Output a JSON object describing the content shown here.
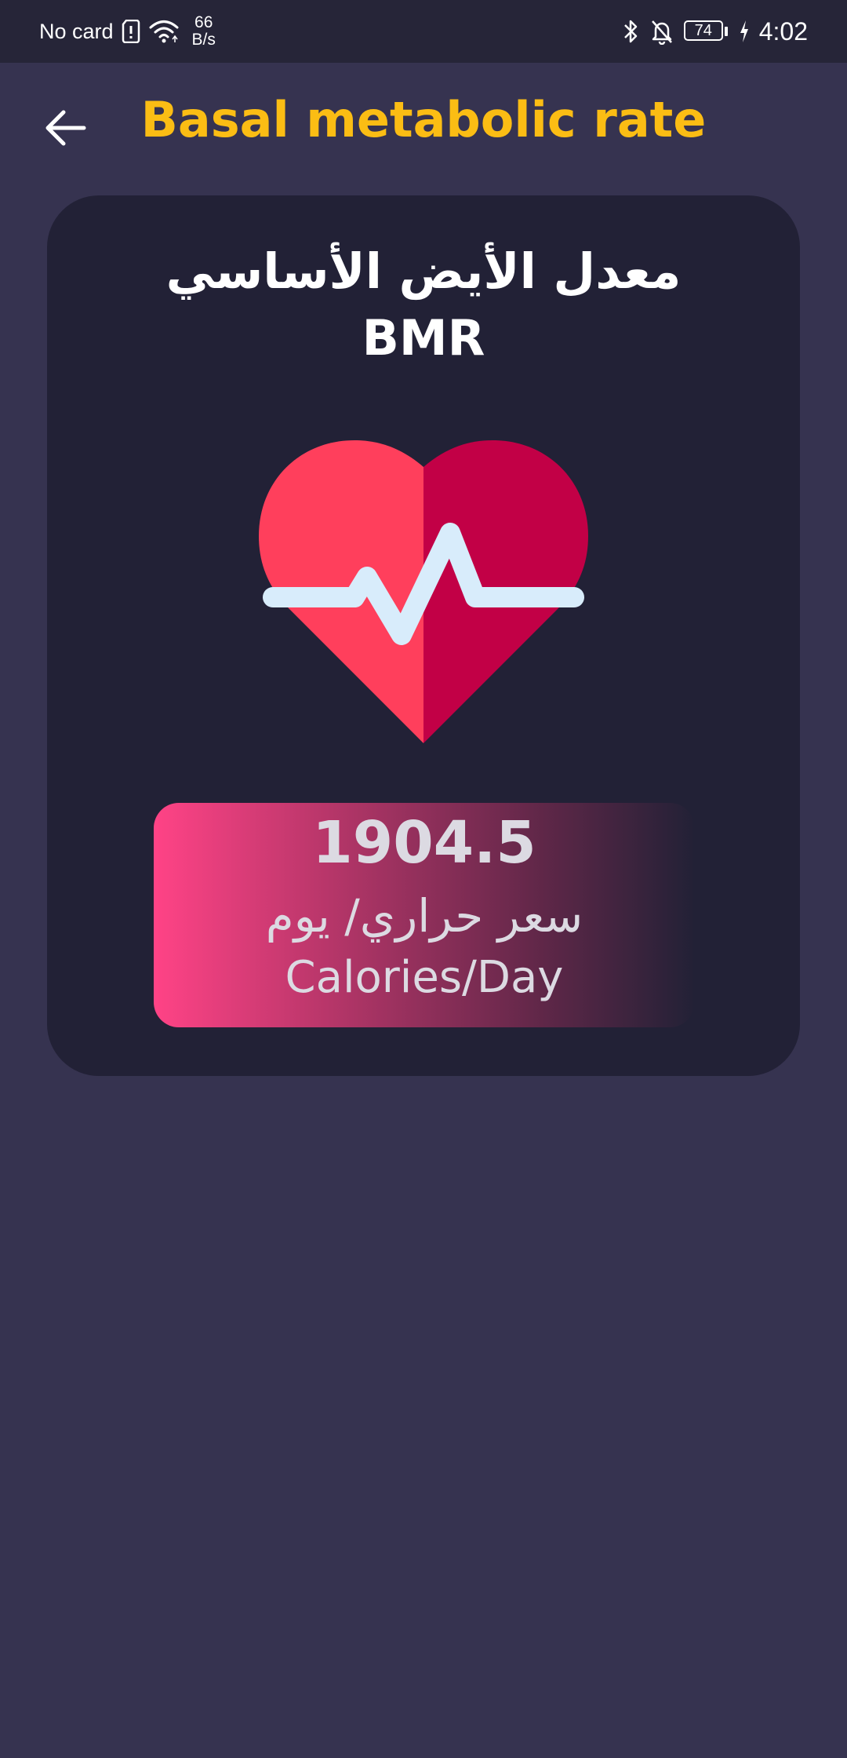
{
  "status_bar": {
    "carrier": "No card",
    "net_speed_value": "66",
    "net_speed_unit": "B/s",
    "battery": "74",
    "time": "4:02"
  },
  "header": {
    "title": "Basal metabolic rate"
  },
  "card": {
    "title_ar": "معدل الأيض الأساسي",
    "title_en": "BMR",
    "result": {
      "value": "1904.5",
      "unit_ar": "سعر حراري/ يوم",
      "unit_en": "Calories/Day"
    }
  },
  "colors": {
    "background": "#363350",
    "card": "#222136",
    "title": "#fbbd14",
    "heart_left": "#ff3f5c",
    "heart_right": "#c20046",
    "pulse": "#d8ecfb",
    "gradient_start": "#ff4386"
  },
  "icons": {
    "back": "arrow-left-icon",
    "heart": "heart-pulse-icon"
  }
}
